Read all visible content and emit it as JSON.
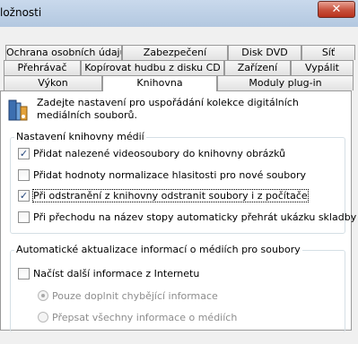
{
  "window": {
    "title": "ložnosti",
    "close_glyph": "✕"
  },
  "tabs": {
    "row1": [
      "Ochrana osobních údajů",
      "Zabezpečení",
      "Disk DVD",
      "Síť"
    ],
    "row2": [
      "Přehrávač",
      "Kopírovat hudbu z disku CD",
      "Zařízení",
      "Vypálit"
    ],
    "row3": [
      "Výkon",
      "Knihovna",
      "Moduly plug-in"
    ],
    "active": "Knihovna"
  },
  "intro": "Zadejte nastavení pro uspořádání kolekce digitálních mediálních souborů.",
  "library_group": {
    "title": "Nastavení knihovny médií",
    "items": [
      {
        "label": "Přidat nalezené videosoubory do knihovny obrázků",
        "checked": true
      },
      {
        "label": "Přidat hodnoty normalizace hlasitosti pro nové soubory",
        "checked": false
      },
      {
        "label": "Při odstranění z knihovny odstranit soubory i z počítače",
        "checked": true
      },
      {
        "label": "Při přechodu na název stopy automaticky přehrát ukázku skladby",
        "checked": false
      }
    ]
  },
  "auto_group": {
    "title": "Automatické aktualizace informací o médiích pro soubory",
    "checkbox": {
      "label": "Načíst další informace z Internetu",
      "checked": false
    },
    "radios": [
      {
        "label": "Pouze doplnit chybějící informace",
        "selected": true
      },
      {
        "label": "Přepsat všechny informace o médiích",
        "selected": false
      }
    ]
  },
  "colors": {
    "check": "#21447b",
    "disabled_text": "#8d8d8d",
    "close_red": "#c7503c"
  }
}
